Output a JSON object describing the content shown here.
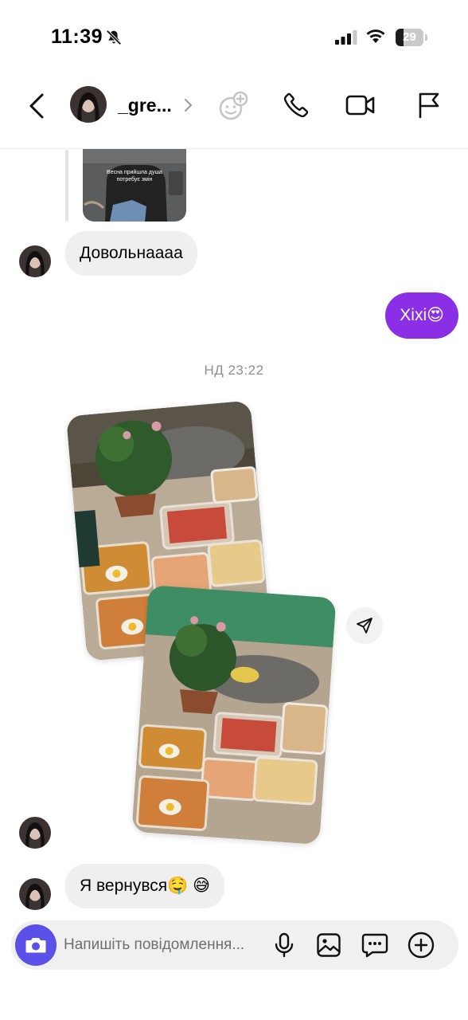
{
  "status_bar": {
    "time": "11:39",
    "battery": "29",
    "battery_level": 0.29
  },
  "header": {
    "username": "_gre..."
  },
  "shared_post": {
    "caption": "Весна прийшла душа потребує змін"
  },
  "messages": [
    {
      "from": "them",
      "text": "Довольнаааа"
    },
    {
      "from": "me",
      "text": "Xixi😍"
    },
    {
      "from": "them",
      "type": "photos",
      "count": 2
    },
    {
      "from": "them",
      "text": "Я вернувся🤤 😅"
    }
  ],
  "timestamp": "НД 23:22",
  "composer": {
    "placeholder": "Напишіть повідомлення..."
  },
  "colors": {
    "accent": "#8b2fe6",
    "camera": "#5b51e8"
  }
}
